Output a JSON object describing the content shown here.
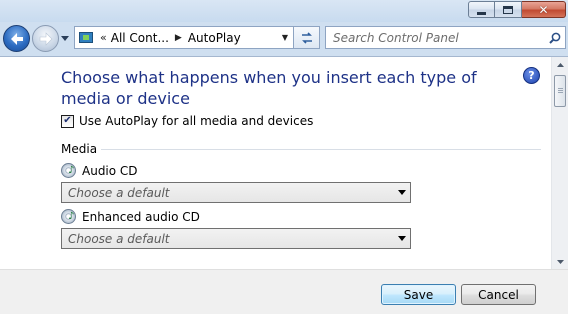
{
  "window": {
    "controls": {
      "minimize": "minimize",
      "maximize": "maximize",
      "close": "close"
    }
  },
  "nav": {
    "breadcrumb": {
      "overflow": "«",
      "items": [
        "All Cont...",
        "AutoPlay"
      ]
    },
    "search": {
      "placeholder": "Search Control Panel"
    }
  },
  "page": {
    "title": "Choose what happens when you insert each type of media or device",
    "help": "?",
    "use_autoplay": {
      "label": "Use AutoPlay for all media and devices",
      "checked": true
    },
    "section": "Media",
    "media": [
      {
        "label": "Audio CD",
        "value": "Choose a default"
      },
      {
        "label": "Enhanced audio CD",
        "value": "Choose a default"
      }
    ]
  },
  "footer": {
    "save": "Save",
    "cancel": "Cancel"
  },
  "colors": {
    "title_blue": "#1e3287",
    "chrome": "#cfdff0",
    "save_button": "#bee6fd"
  },
  "icons": [
    "back-arrow-icon",
    "forward-arrow-icon",
    "control-panel-icon",
    "refresh-icon",
    "search-icon",
    "help-icon",
    "audio-cd-icon",
    "chevron-down-icon"
  ]
}
